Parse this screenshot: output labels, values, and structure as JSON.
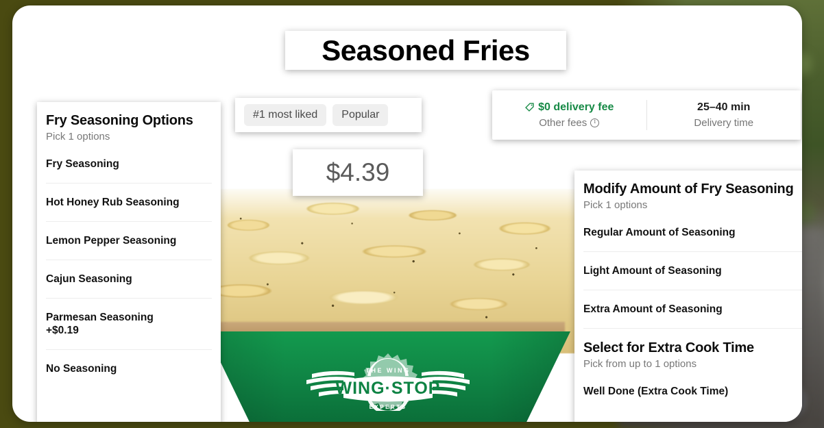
{
  "item": {
    "title": "Seasoned Fries",
    "price": "$4.39"
  },
  "badges": [
    {
      "label": "#1 most liked"
    },
    {
      "label": "Popular"
    }
  ],
  "delivery": {
    "fee": {
      "icon": "tag-icon",
      "headline": "$0 delivery fee",
      "sublabel": "Other fees",
      "sub_icon": "info-circle-icon",
      "color": "#178a46"
    },
    "time": {
      "headline": "25–40 min",
      "sublabel": "Delivery time"
    }
  },
  "option_groups": [
    {
      "id": "fry-seasoning-options",
      "title": "Fry Seasoning Options",
      "subtitle": "Pick 1 options",
      "options": [
        {
          "label": "Fry Seasoning",
          "price": ""
        },
        {
          "label": "Hot Honey Rub Seasoning",
          "price": ""
        },
        {
          "label": "Lemon Pepper Seasoning",
          "price": ""
        },
        {
          "label": "Cajun Seasoning",
          "price": ""
        },
        {
          "label": "Parmesan Seasoning",
          "price": "+$0.19"
        },
        {
          "label": "No Seasoning",
          "price": ""
        }
      ]
    },
    {
      "id": "modify-amount-of-fry-seasoning",
      "title": "Modify Amount of Fry Seasoning",
      "subtitle": "Pick 1 options",
      "options": [
        {
          "label": "Regular Amount of Seasoning",
          "price": ""
        },
        {
          "label": "Light Amount of Seasoning",
          "price": ""
        },
        {
          "label": "Extra Amount of Seasoning",
          "price": ""
        }
      ]
    },
    {
      "id": "select-for-extra-cook-time",
      "title": "Select for Extra Cook Time",
      "subtitle": "Pick from up to 1 options",
      "options": [
        {
          "label": "Well Done (Extra Cook Time)",
          "price": ""
        }
      ]
    }
  ],
  "hero": {
    "brand_logo_top_text": "THE WING",
    "brand_logo_main_text": "WING·STOP",
    "brand_logo_bottom_text": "EXPERTS",
    "box_color": "#0f8344"
  }
}
